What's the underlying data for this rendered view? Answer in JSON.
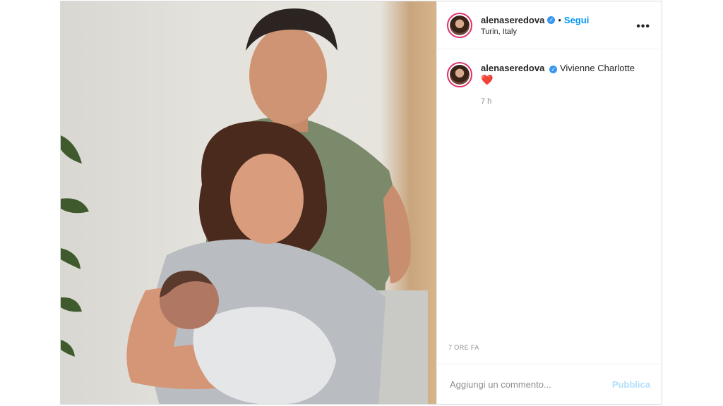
{
  "post": {
    "header": {
      "username": "alenaseredova",
      "verified_mark": "✓",
      "separator": "•",
      "follow_label": "Segui",
      "location": "Turin, Italy",
      "more_label": "•••"
    },
    "caption": {
      "username": "alenaseredova",
      "text": "Vivienne Charlotte",
      "emoji": "❤️",
      "time": "7 h"
    },
    "time_ago": "7 ORE FA",
    "comment": {
      "placeholder": "Aggiungi un commento...",
      "publish_label": "Pubblica"
    }
  },
  "colors": {
    "accent": "#0095f6",
    "publish_disabled": "#b2dffc",
    "verified": "#3897f0",
    "heart": "#e0245e",
    "story_ring": "#e1306c"
  },
  "icons": {
    "verified": "verified-badge-icon",
    "more": "more-options-icon",
    "heart": "heart-emoji-icon"
  }
}
